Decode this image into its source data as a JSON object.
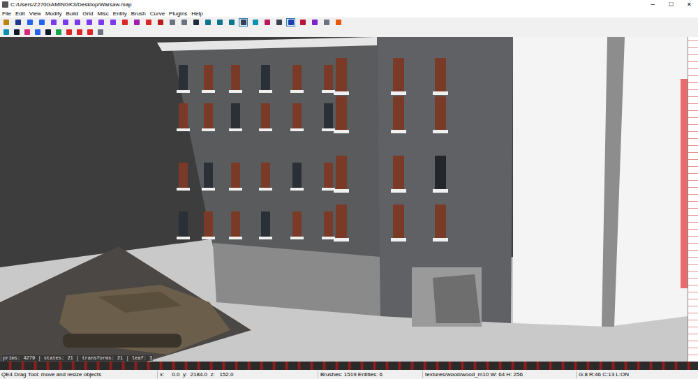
{
  "window": {
    "title": "C:/Users/Z270GAMINGK3/Desktop/Warsaw.map",
    "controls": [
      "─",
      "☐",
      "✕"
    ]
  },
  "menu": [
    "File",
    "Edit",
    "View",
    "Modify",
    "Build",
    "Grid",
    "Misc",
    "Entity",
    "Brush",
    "Curve",
    "Plugins",
    "Help"
  ],
  "toolbar_top": [
    {
      "selected": false
    },
    {
      "selected": false
    },
    {
      "selected": false
    },
    {
      "selected": false
    },
    {
      "selected": false
    },
    {
      "selected": false
    },
    {
      "selected": false
    },
    {
      "selected": false
    },
    {
      "selected": false
    },
    {
      "selected": false
    },
    {
      "selected": false
    },
    {
      "selected": false
    },
    {
      "selected": false
    },
    {
      "selected": false
    },
    {
      "selected": false
    },
    {
      "selected": false
    },
    {
      "selected": false
    },
    {
      "selected": false
    },
    {
      "selected": false
    },
    {
      "selected": false
    },
    {
      "selected": true
    },
    {
      "selected": false
    },
    {
      "selected": false
    },
    {
      "selected": false
    },
    {
      "selected": true
    },
    {
      "selected": false
    },
    {
      "selected": false
    },
    {
      "selected": false
    },
    {
      "selected": false
    }
  ],
  "toolbar_bottom": [
    {
      "selected": false
    },
    {
      "selected": false
    },
    {
      "selected": false
    },
    {
      "selected": false
    },
    {
      "selected": false
    },
    {
      "selected": false
    },
    {
      "selected": false
    },
    {
      "selected": false
    },
    {
      "selected": false
    },
    {
      "selected": false
    }
  ],
  "viewport": {
    "stats": "prims: 4279 | states: 21 | transforms: 21 | leaf: 3"
  },
  "status_bar": {
    "tool": "QE4 Drag Tool: move and resize objects",
    "position": "x:     0.0  y:  2184.0  z:   152.0",
    "counts": "Brushes: 1519 Entities: 6",
    "texture": "textures/wood/wood_m10 W: 64 H: 256",
    "grid": "G:8 R:46 C:13 L:ON"
  }
}
